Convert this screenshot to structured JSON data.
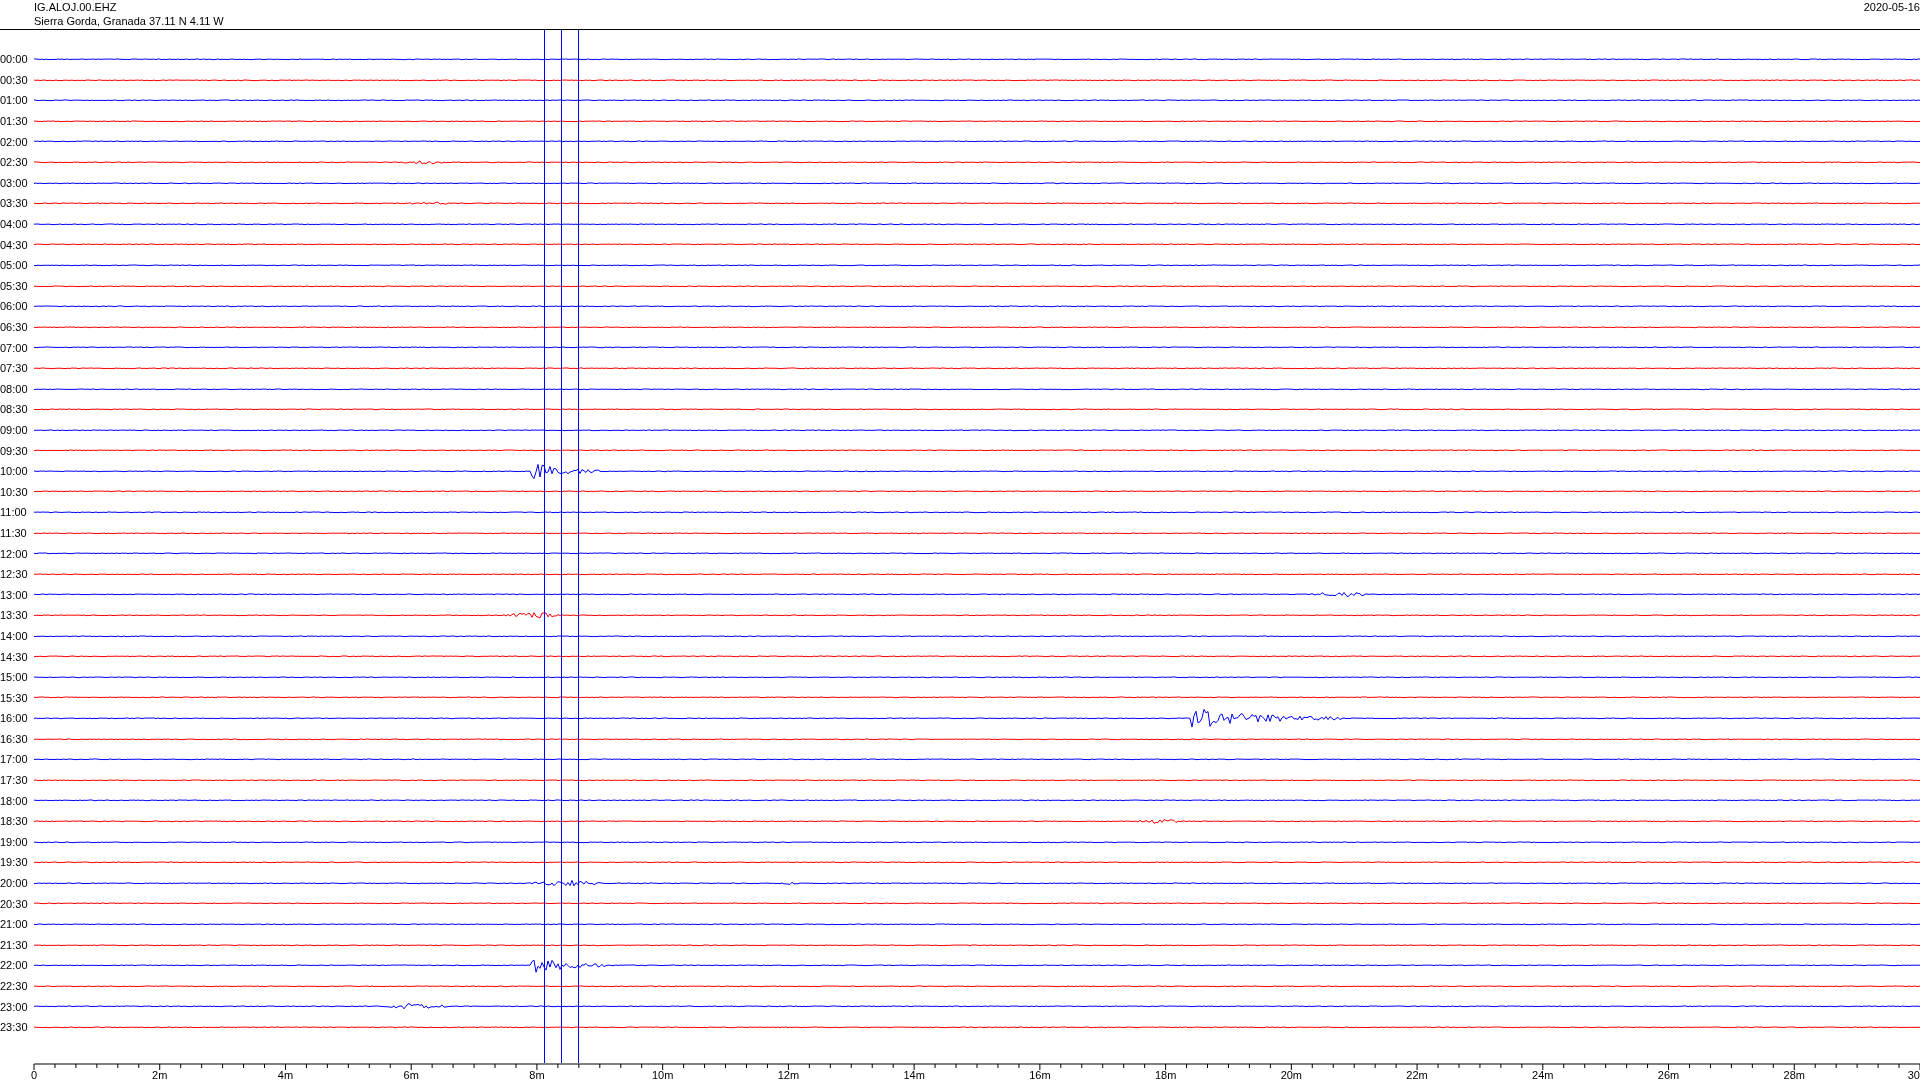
{
  "header": {
    "station": "IG.ALOJ.00.EHZ",
    "location": "Sierra Gorda, Granada  37.11 N 4.11 W",
    "date": "2020-05-16"
  },
  "rows": [
    {
      "time": "00:00",
      "color": "#0000ff"
    },
    {
      "time": "00:30",
      "color": "#ff0000"
    },
    {
      "time": "01:00",
      "color": "#0000ff"
    },
    {
      "time": "01:30",
      "color": "#ff0000"
    },
    {
      "time": "02:00",
      "color": "#0000ff"
    },
    {
      "time": "02:30",
      "color": "#ff0000"
    },
    {
      "time": "03:00",
      "color": "#0000ff"
    },
    {
      "time": "03:30",
      "color": "#ff0000"
    },
    {
      "time": "04:00",
      "color": "#0000ff"
    },
    {
      "time": "04:30",
      "color": "#ff0000"
    },
    {
      "time": "05:00",
      "color": "#0000ff"
    },
    {
      "time": "05:30",
      "color": "#ff0000"
    },
    {
      "time": "06:00",
      "color": "#0000ff"
    },
    {
      "time": "06:30",
      "color": "#ff0000"
    },
    {
      "time": "07:00",
      "color": "#0000ff"
    },
    {
      "time": "07:30",
      "color": "#ff0000"
    },
    {
      "time": "08:00",
      "color": "#0000ff"
    },
    {
      "time": "08:30",
      "color": "#ff0000"
    },
    {
      "time": "09:00",
      "color": "#0000ff"
    },
    {
      "time": "09:30",
      "color": "#ff0000"
    },
    {
      "time": "10:00",
      "color": "#0000ff"
    },
    {
      "time": "10:30",
      "color": "#ff0000"
    },
    {
      "time": "11:00",
      "color": "#0000ff"
    },
    {
      "time": "11:30",
      "color": "#ff0000"
    },
    {
      "time": "12:00",
      "color": "#0000ff"
    },
    {
      "time": "12:30",
      "color": "#ff0000"
    },
    {
      "time": "13:00",
      "color": "#0000ff"
    },
    {
      "time": "13:30",
      "color": "#ff0000"
    },
    {
      "time": "14:00",
      "color": "#0000ff"
    },
    {
      "time": "14:30",
      "color": "#ff0000"
    },
    {
      "time": "15:00",
      "color": "#0000ff"
    },
    {
      "time": "15:30",
      "color": "#ff0000"
    },
    {
      "time": "16:00",
      "color": "#0000ff"
    },
    {
      "time": "16:30",
      "color": "#ff0000"
    },
    {
      "time": "17:00",
      "color": "#0000ff"
    },
    {
      "time": "17:30",
      "color": "#ff0000"
    },
    {
      "time": "18:00",
      "color": "#0000ff"
    },
    {
      "time": "18:30",
      "color": "#ff0000"
    },
    {
      "time": "19:00",
      "color": "#0000ff"
    },
    {
      "time": "19:30",
      "color": "#ff0000"
    },
    {
      "time": "20:00",
      "color": "#0000ff"
    },
    {
      "time": "20:30",
      "color": "#ff0000"
    },
    {
      "time": "21:00",
      "color": "#0000ff"
    },
    {
      "time": "21:30",
      "color": "#ff0000"
    },
    {
      "time": "22:00",
      "color": "#0000ff"
    },
    {
      "time": "22:30",
      "color": "#ff0000"
    },
    {
      "time": "23:00",
      "color": "#0000ff"
    },
    {
      "time": "23:30",
      "color": "#ff0000"
    }
  ],
  "x_axis": {
    "ticks": [
      "0",
      "2m",
      "4m",
      "6m",
      "8m",
      "10m",
      "12m",
      "14m",
      "16m",
      "18m",
      "20m",
      "22m",
      "24m",
      "26m",
      "28m",
      "30"
    ]
  }
}
